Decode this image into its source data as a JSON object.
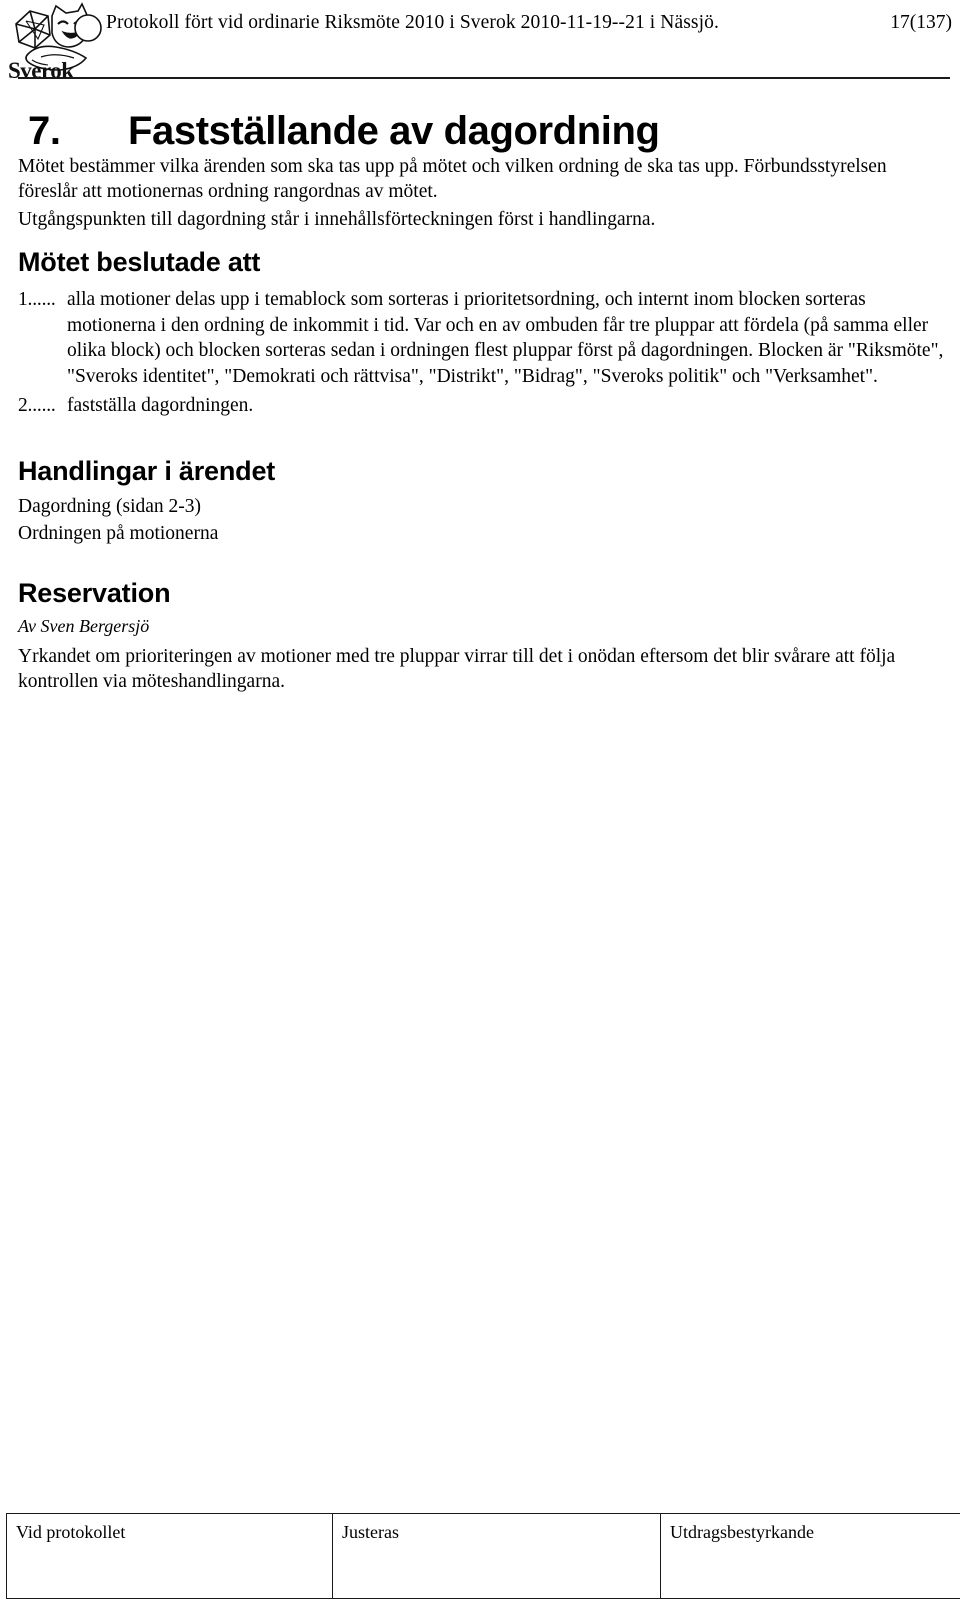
{
  "header": {
    "logo_name": "sverok-logo",
    "logo_wordmark": "Sverok",
    "title": "Protokoll fört vid ordinarie Riksmöte 2010 i Sverok 2010-11-19--21 i Nässjö.",
    "page_number": "17(137)"
  },
  "section": {
    "number": "7.",
    "title": "Fastställande av dagordning",
    "intro_paragraphs": [
      "Mötet bestämmer vilka ärenden som ska tas upp på mötet och vilken ordning de ska tas upp. Förbundsstyrelsen föreslår att motionernas ordning rangordnas av mötet.",
      "Utgångspunkten till dagordning står i innehållsförteckningen först i handlingarna."
    ]
  },
  "decisions": {
    "heading": "Mötet beslutade att",
    "items": [
      {
        "marker": "1......",
        "text": "alla motioner delas upp i temablock som sorteras i prioritetsordning, och internt inom blocken sorteras motionerna i den ordning de inkommit i tid. Var och en av ombuden får tre pluppar att fördela (på samma eller olika block) och blocken sorteras sedan i ordningen flest pluppar först på dagordningen. Blocken är \"Riksmöte\", \"Sveroks identitet\", \"Demokrati och rättvisa\", \"Distrikt\", \"Bidrag\", \"Sveroks politik\" och \"Verksamhet\"."
      },
      {
        "marker": "2......",
        "text": "fastställa dagordningen."
      }
    ]
  },
  "documents": {
    "heading": "Handlingar i ärendet",
    "items": [
      "Dagordning (sidan 2-3)",
      "Ordningen på motionerna"
    ]
  },
  "reservation": {
    "heading": "Reservation",
    "author": "Av Sven Bergersjö",
    "text": "Yrkandet om prioriteringen av motioner med tre pluppar virrar till det i onödan eftersom det blir svårare att följa kontrollen via möteshandlingarna."
  },
  "footer": {
    "columns": [
      "Vid protokollet",
      "Justeras",
      "Utdragsbestyrkande"
    ]
  },
  "colors": {
    "text": "#000000",
    "rule": "#1a1a1a",
    "background": "#ffffff"
  }
}
